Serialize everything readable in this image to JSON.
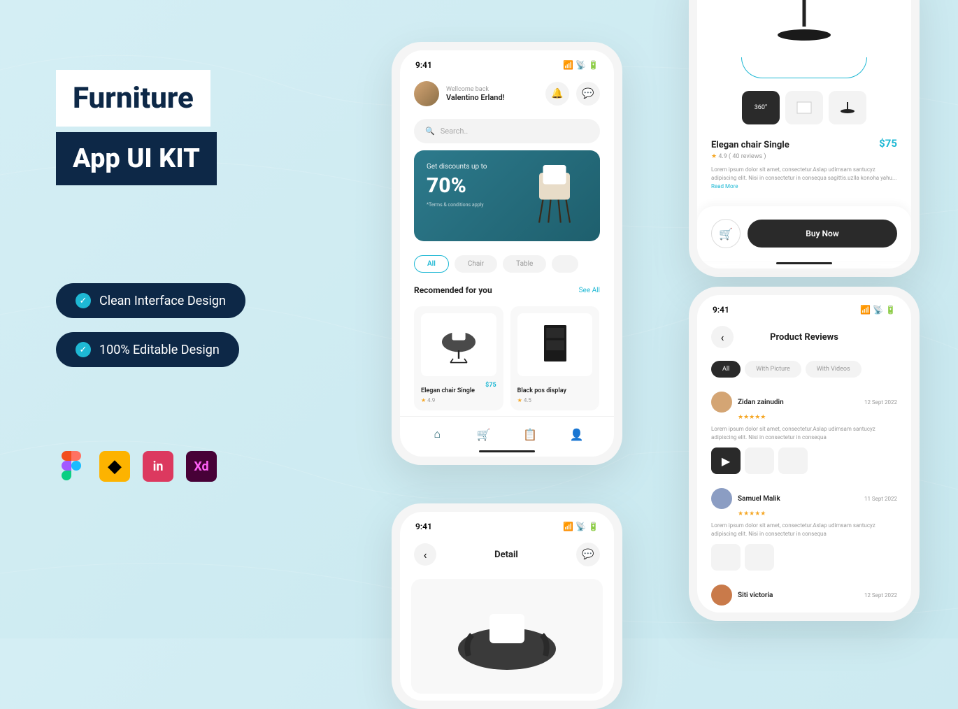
{
  "marketing": {
    "title": "Furniture",
    "subtitle": "App UI KIT",
    "features": [
      "Clean Interface Design",
      "100% Editable Design"
    ]
  },
  "home": {
    "time": "9:41",
    "welcome": "Wellcome back",
    "username": "Valentino Erland!",
    "search_placeholder": "Search..",
    "promo": {
      "label": "Get discounts up to",
      "percent": "70%",
      "terms": "*Terms & conditions apply"
    },
    "chips": [
      "All",
      "Chair",
      "Table"
    ],
    "section_title": "Recomended for you",
    "see_all": "See All",
    "products": [
      {
        "name": "Elegan chair Single",
        "price": "$75",
        "rating": "4.9"
      },
      {
        "name": "Black pos display",
        "price": "",
        "rating": "4.5"
      }
    ]
  },
  "detail_top": {
    "thumb_360": "360°",
    "title": "Elegan chair Single",
    "price": "$75",
    "rating": "4.9 ( 40 reviews )",
    "description": "Lorem ipsum dolor sit amet, consectetur.Aslap udimsam santucyz adipiscing elit. Nisi in consectetur in consequa sagittis.uzlla konoha yahu... ",
    "read_more": "Read More",
    "buy_label": "Buy Now"
  },
  "detail_bottom": {
    "time": "9:41",
    "title": "Detail"
  },
  "reviews": {
    "time": "9:41",
    "title": "Product Reviews",
    "tabs": [
      "All",
      "With Picture",
      "With Videos"
    ],
    "items": [
      {
        "name": "Zidan zainudin",
        "date": "12 Sept 2022",
        "text": "Lorem ipsum dolor sit amet, consectetur.Aslap udimsam santucyz adipiscing elit. Nisi in consectetur in consequa"
      },
      {
        "name": "Samuel Malik",
        "date": "11 Sept 2022",
        "text": "Lorem ipsum dolor sit amet, consectetur.Aslap udimsam santucyz adipiscing elit. Nisi in consectetur in consequa"
      },
      {
        "name": "Siti victoria",
        "date": "12 Sept 2022",
        "text": ""
      }
    ]
  }
}
